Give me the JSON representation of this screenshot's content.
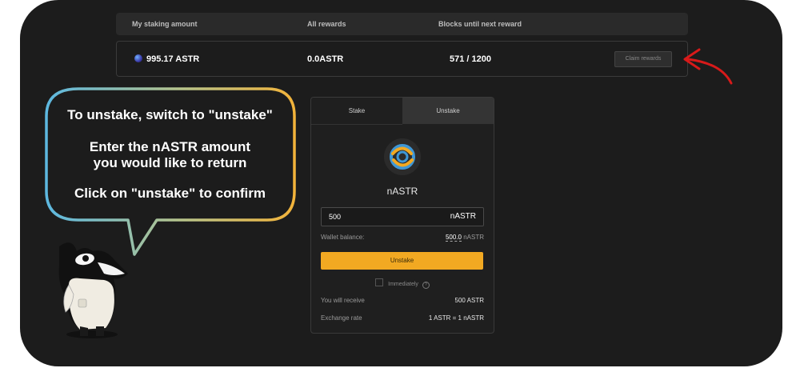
{
  "table": {
    "headers": [
      "My staking amount",
      "All rewards",
      "Blocks until next reward"
    ],
    "row": {
      "staking_amount": "995.17 ASTR",
      "all_rewards": "0.0ASTR",
      "blocks": "571 / 1200",
      "claim_label": "Claim rewards"
    }
  },
  "card": {
    "tabs": [
      "Stake",
      "Unstake"
    ],
    "token_name": "nASTR",
    "amount_value": "500",
    "amount_unit": "nASTR",
    "wallet_balance_label": "Wallet balance:",
    "wallet_balance_value": "500.0",
    "wallet_balance_unit": "nASTR",
    "action_label": "Unstake",
    "immediately_label": "Immediately",
    "receive_label": "You will receive",
    "receive_value": "500 ASTR",
    "rate_label": "Exchange rate",
    "rate_value": "1 ASTR = 1 nASTR"
  },
  "bubble": {
    "line1": "To unstake, switch to \"unstake\"",
    "line2a": "Enter the nASTR amount",
    "line2b": "you would like to return",
    "line3": "Click on \"unstake\" to confirm"
  },
  "colors": {
    "background": "#1c1c1c",
    "accent": "#f2a922",
    "arrow": "#d81a1a"
  },
  "icons": [
    "astr-token-icon",
    "nastr-token-icon",
    "red-arrow-icon",
    "info-icon",
    "orca-mascot-icon"
  ]
}
